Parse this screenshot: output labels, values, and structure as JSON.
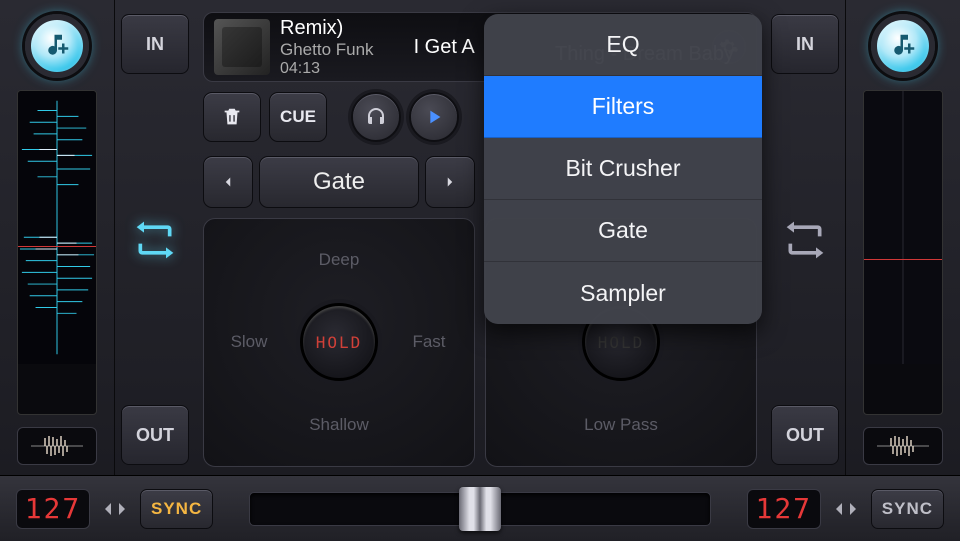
{
  "deck_left": {
    "io_in": "IN",
    "io_out": "OUT",
    "bpm": "127",
    "sync": "SYNC"
  },
  "deck_right": {
    "io_in": "IN",
    "io_out": "OUT",
    "bpm": "127",
    "sync": "SYNC"
  },
  "tracks": {
    "a": {
      "title": "Remix)",
      "artist": "Ghetto Funk",
      "time": "04:13"
    },
    "b": {
      "title_fragment": "I Get A"
    },
    "c": {
      "title_fragment": "Thing - Dream Baby"
    }
  },
  "toolbar": {
    "cue": "CUE"
  },
  "fx_left": {
    "name": "Gate",
    "top": "Deep",
    "bottom": "Shallow",
    "left": "Slow",
    "right": "Fast",
    "hold": "HOLD"
  },
  "fx_right": {
    "bottom": "Low Pass",
    "hold": "HOLD"
  },
  "popover": {
    "items": [
      "EQ",
      "Filters",
      "Bit Crusher",
      "Gate",
      "Sampler"
    ],
    "selected_index": 1
  }
}
